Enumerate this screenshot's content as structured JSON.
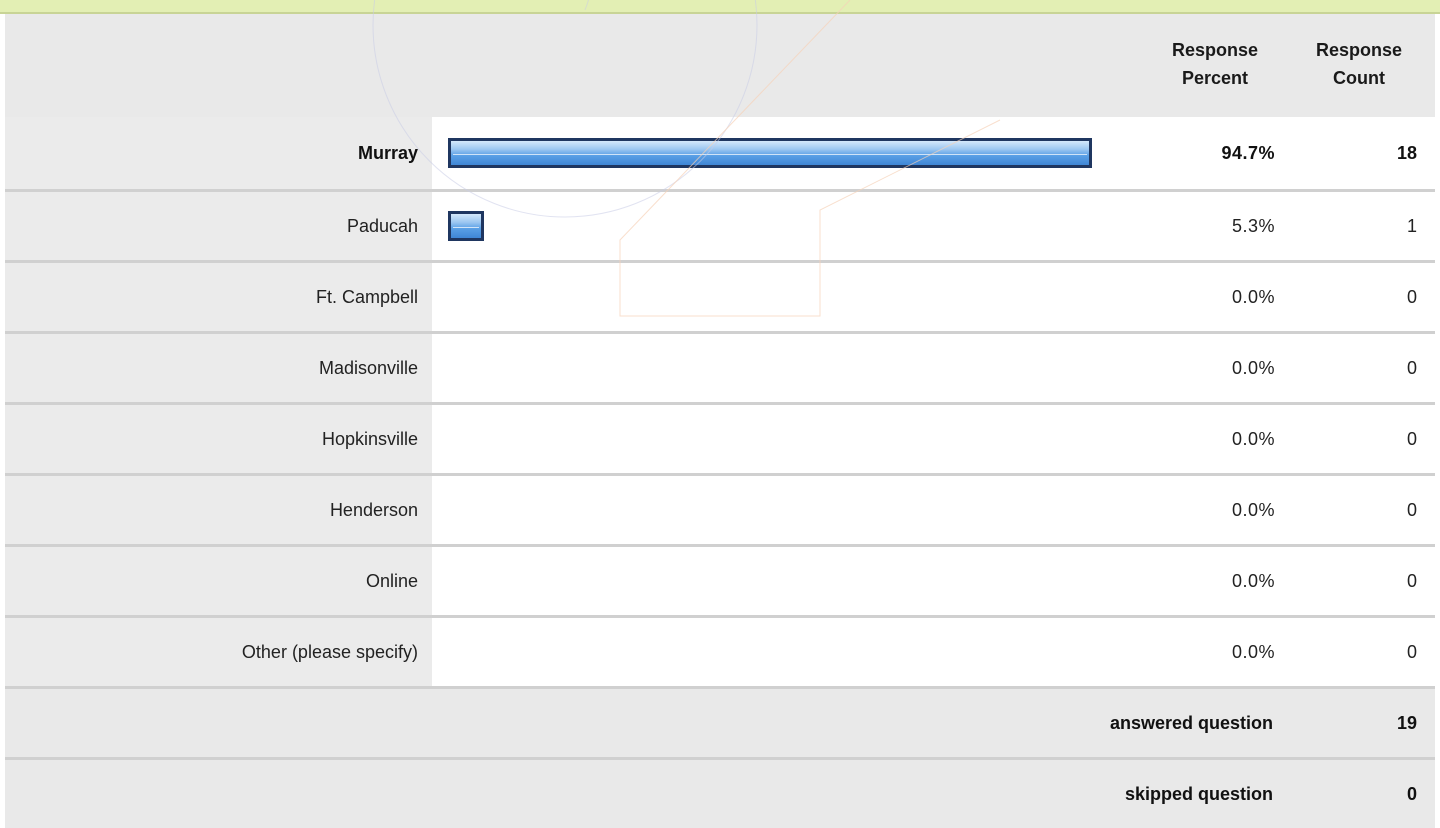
{
  "chart_data": {
    "type": "bar",
    "columns": {
      "percent": "Response Percent",
      "count": "Response Count"
    },
    "max_percent": 100,
    "rows": [
      {
        "label": "Murray",
        "percent": 94.7,
        "percent_text": "94.7%",
        "count": "18"
      },
      {
        "label": "Paducah",
        "percent": 5.3,
        "percent_text": "5.3%",
        "count": "1"
      },
      {
        "label": "Ft. Campbell",
        "percent": 0,
        "percent_text": "0.0%",
        "count": "0"
      },
      {
        "label": "Madisonville",
        "percent": 0,
        "percent_text": "0.0%",
        "count": "0"
      },
      {
        "label": "Hopkinsville",
        "percent": 0,
        "percent_text": "0.0%",
        "count": "0"
      },
      {
        "label": "Henderson",
        "percent": 0,
        "percent_text": "0.0%",
        "count": "0"
      },
      {
        "label": "Online",
        "percent": 0,
        "percent_text": "0.0%",
        "count": "0"
      },
      {
        "label": "Other (please specify)",
        "percent": 0,
        "percent_text": "0.0%",
        "count": "0"
      }
    ],
    "summary": [
      {
        "label": "answered question",
        "value": "19"
      },
      {
        "label": "skipped question",
        "value": "0"
      }
    ]
  },
  "colors": {
    "bar_border": "#1f3660",
    "bar_fill": "#5aa0e6",
    "label_bg": "#ebebeb",
    "header_bg": "#e9e9e9",
    "top_band": "#e3efb4"
  }
}
